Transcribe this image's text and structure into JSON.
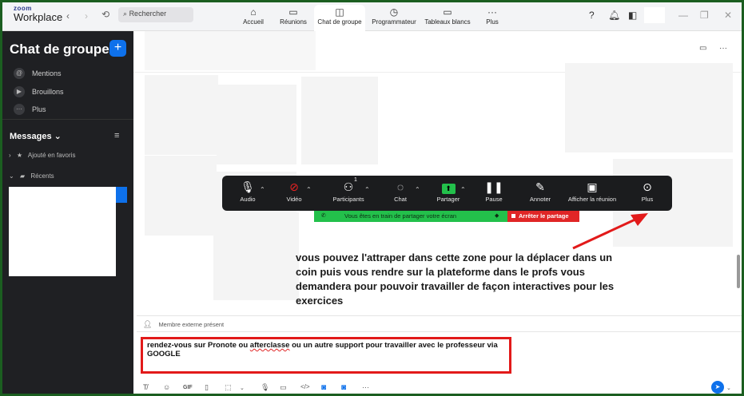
{
  "titlebar": {
    "logo_top": "zoom",
    "logo_bottom": "Workplace",
    "search_placeholder": "Rechercher",
    "tabs": [
      {
        "label": "Accueil",
        "icon": "home-icon"
      },
      {
        "label": "Réunions",
        "icon": "video-icon"
      },
      {
        "label": "Chat de groupe",
        "icon": "chat-icon"
      },
      {
        "label": "Programmateur",
        "icon": "clock-icon"
      },
      {
        "label": "Tableaux blancs",
        "icon": "whiteboard-icon"
      },
      {
        "label": "Plus",
        "icon": "more-icon"
      }
    ]
  },
  "sidebar": {
    "title": "Chat de groupe",
    "items": [
      {
        "label": "Mentions",
        "icon": "@"
      },
      {
        "label": "Brouillons",
        "icon": "▶"
      },
      {
        "label": "Plus",
        "icon": "···"
      }
    ],
    "messages_label": "Messages",
    "sections": [
      {
        "label": "Ajouté en favoris"
      },
      {
        "label": "Récents"
      }
    ]
  },
  "meeting_toolbar": {
    "buttons": [
      {
        "label": "Audio",
        "icon": "🎤"
      },
      {
        "label": "Vidéo",
        "icon": "📹"
      },
      {
        "label": "Participants",
        "icon": "👥",
        "count": "1"
      },
      {
        "label": "Chat",
        "icon": "💬"
      },
      {
        "label": "Partager",
        "icon": "⬆"
      },
      {
        "label": "Pause",
        "icon": "❚❚"
      },
      {
        "label": "Annoter",
        "icon": "✎"
      },
      {
        "label": "Afficher la réunion",
        "icon": "▣"
      },
      {
        "label": "Plus",
        "icon": "⋯"
      }
    ],
    "share_status": "Vous êtes en train de partager votre écran",
    "stop_share": "Arrêter le partage"
  },
  "instructions": "vous pouvez l'attraper dans cette zone pour la déplacer dans un coin puis vous rendre sur la plateforme dans le profs vous demandera pour pouvoir travailler de façon interactives pour les exercices",
  "external_member": "Membre externe présent",
  "composer": {
    "text_before": "rendez-vous sur Pronote ou ",
    "text_misspelled": "afterclasse",
    "text_after": " ou un autre support pour travailler avec le professeur via GOOGLE"
  },
  "colors": {
    "accent": "#0e71eb",
    "share_green": "#23c04b",
    "alert_red": "#e21a1a",
    "sidebar_bg": "#1f2023"
  }
}
